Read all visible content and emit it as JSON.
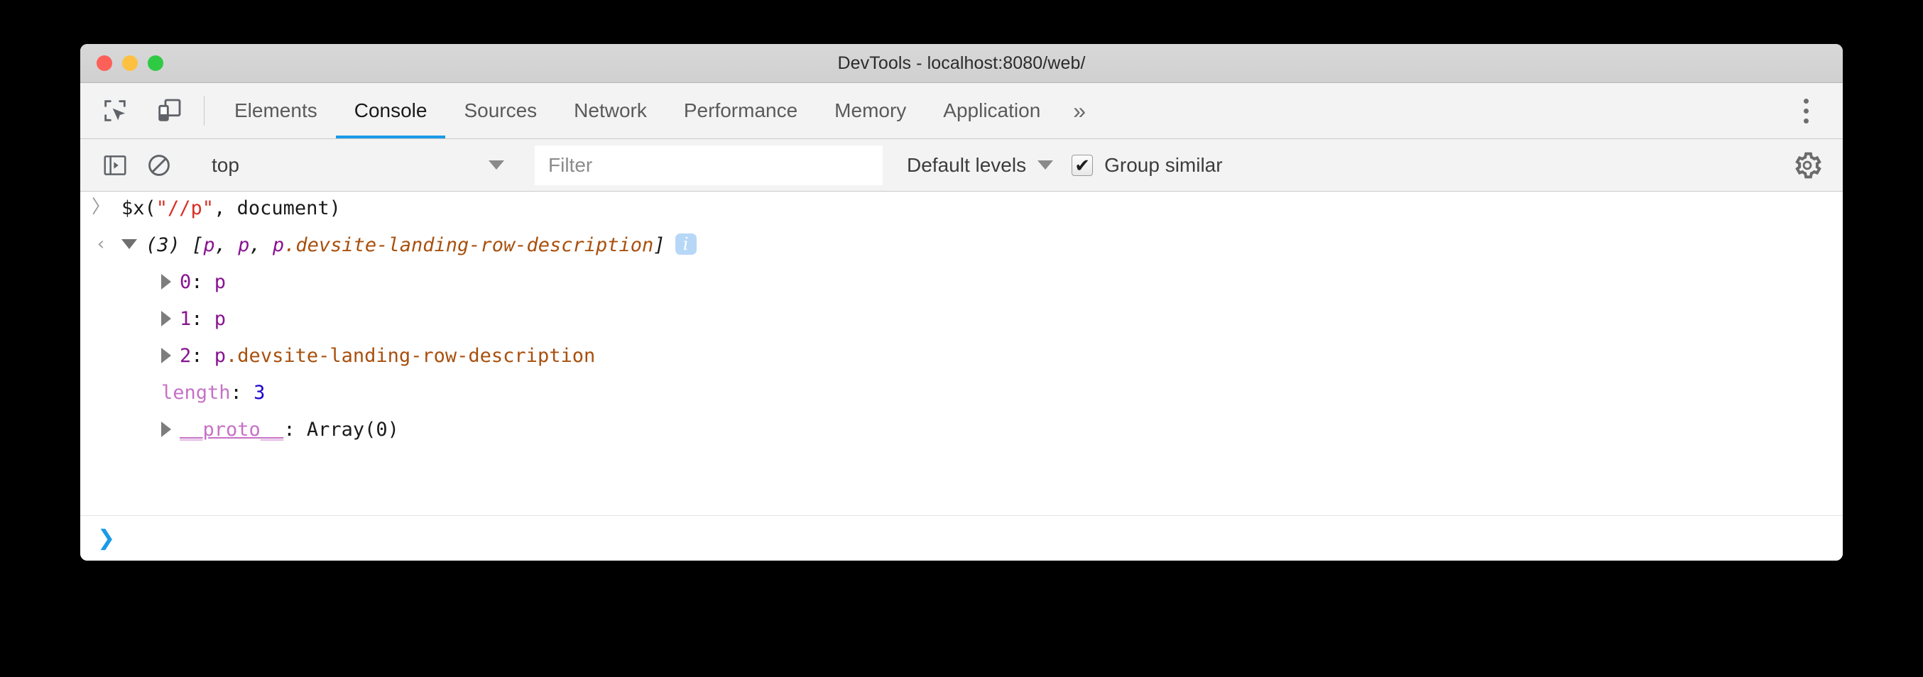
{
  "window": {
    "title": "DevTools - localhost:8080/web/",
    "traffic_lights": [
      {
        "name": "close",
        "color": "#fc6058"
      },
      {
        "name": "minimize",
        "color": "#fec041"
      },
      {
        "name": "maximize",
        "color": "#2fca43"
      }
    ]
  },
  "toolbar_icons": {
    "inspect": "inspect-element-icon",
    "device": "device-toolbar-icon",
    "kebab": "more-options-icon"
  },
  "tabs": [
    {
      "label": "Elements",
      "active": false
    },
    {
      "label": "Console",
      "active": true
    },
    {
      "label": "Sources",
      "active": false
    },
    {
      "label": "Network",
      "active": false
    },
    {
      "label": "Performance",
      "active": false
    },
    {
      "label": "Memory",
      "active": false
    },
    {
      "label": "Application",
      "active": false
    }
  ],
  "tabs_overflow": "»",
  "console_toolbar": {
    "sidebar_toggle_icon": "console-sidebar-icon",
    "clear_icon": "clear-console-icon",
    "context": "top",
    "context_caret": "▼",
    "filter_placeholder": "Filter",
    "filter_value": "",
    "levels_label": "Default levels",
    "levels_caret": "▼",
    "group_similar_label": "Group similar",
    "group_similar_checked": true,
    "group_similar_check_glyph": "✔",
    "settings_icon": "gear-icon"
  },
  "console": {
    "input_marker": "〉",
    "output_marker": "‹",
    "command": {
      "prefix": "$x(",
      "string": "\"//p\"",
      "suffix": ", document)"
    },
    "result": {
      "count": "(3)",
      "open_bracket": "[",
      "items": [
        "p",
        "p",
        "p"
      ],
      "item_class": ".devsite-landing-row-description",
      "close_bracket": "]",
      "badge": "i",
      "expanded": true
    },
    "properties": [
      {
        "key": "0",
        "key_type": "index",
        "value": "p",
        "value_class": "",
        "expandable": true
      },
      {
        "key": "1",
        "key_type": "index",
        "value": "p",
        "value_class": "",
        "expandable": true
      },
      {
        "key": "2",
        "key_type": "index",
        "value": "p",
        "value_class": ".devsite-landing-row-description",
        "expandable": true
      },
      {
        "key": "length",
        "key_type": "prop",
        "value": "3",
        "value_type": "number",
        "expandable": false
      },
      {
        "key": "__proto__",
        "key_type": "proto",
        "value": "Array(0)",
        "value_type": "object",
        "expandable": true
      }
    ]
  },
  "prompt": {
    "marker": "❯",
    "value": ""
  },
  "colors": {
    "accent": "#1a9ae8",
    "string": "#d93025",
    "tag": "#881391",
    "class": "#a8500e",
    "property": "#c671c6",
    "number": "#1c00cf",
    "badge_bg": "#b7d7f7"
  }
}
